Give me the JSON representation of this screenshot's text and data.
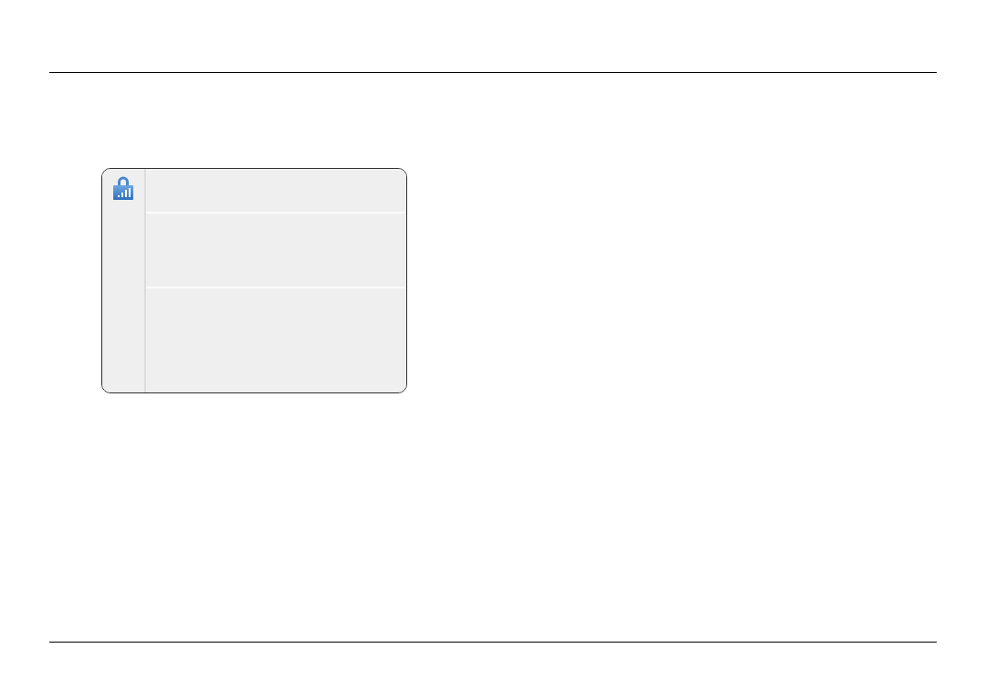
{
  "dialog": {
    "panes": [
      {
        "kind": "blank"
      },
      {
        "kind": "blank"
      },
      {
        "kind": "blank"
      }
    ]
  }
}
